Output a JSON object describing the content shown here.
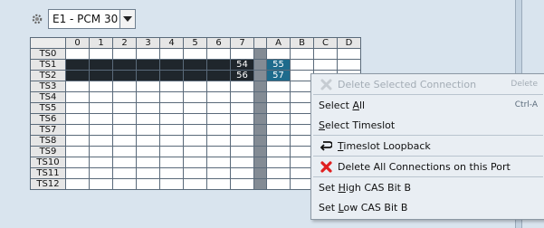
{
  "toolbar": {
    "port_select": "E1 - PCM 30"
  },
  "grid": {
    "columns": [
      "0",
      "1",
      "2",
      "3",
      "4",
      "5",
      "6",
      "7",
      "A",
      "B",
      "C",
      "D"
    ],
    "rows": [
      "TS0",
      "TS1",
      "TS2",
      "TS3",
      "TS4",
      "TS5",
      "TS6",
      "TS7",
      "TS8",
      "TS9",
      "TS10",
      "TS11",
      "TS12"
    ],
    "ts1_col7": "54",
    "ts1_colA": "55",
    "ts2_col7": "56",
    "ts2_colA": "57"
  },
  "context_menu": {
    "delete_selected": {
      "label": "Delete Selected Connection",
      "shortcut": "Delete"
    },
    "select_all": {
      "pre": "Select ",
      "u": "A",
      "post": "ll",
      "shortcut": "Ctrl-A"
    },
    "select_timeslot": {
      "pre": "",
      "u": "S",
      "post": "elect Timeslot"
    },
    "timeslot_loopback": {
      "pre": "",
      "u": "T",
      "post": "imeslot Loopback"
    },
    "delete_all": {
      "label": "Delete All Connections on this Port"
    },
    "set_high_cas": {
      "pre": "Set ",
      "u": "H",
      "post": "igh CAS Bit B"
    },
    "set_low_cas": {
      "pre": "Set ",
      "u": "L",
      "post": "ow CAS Bit B"
    }
  }
}
